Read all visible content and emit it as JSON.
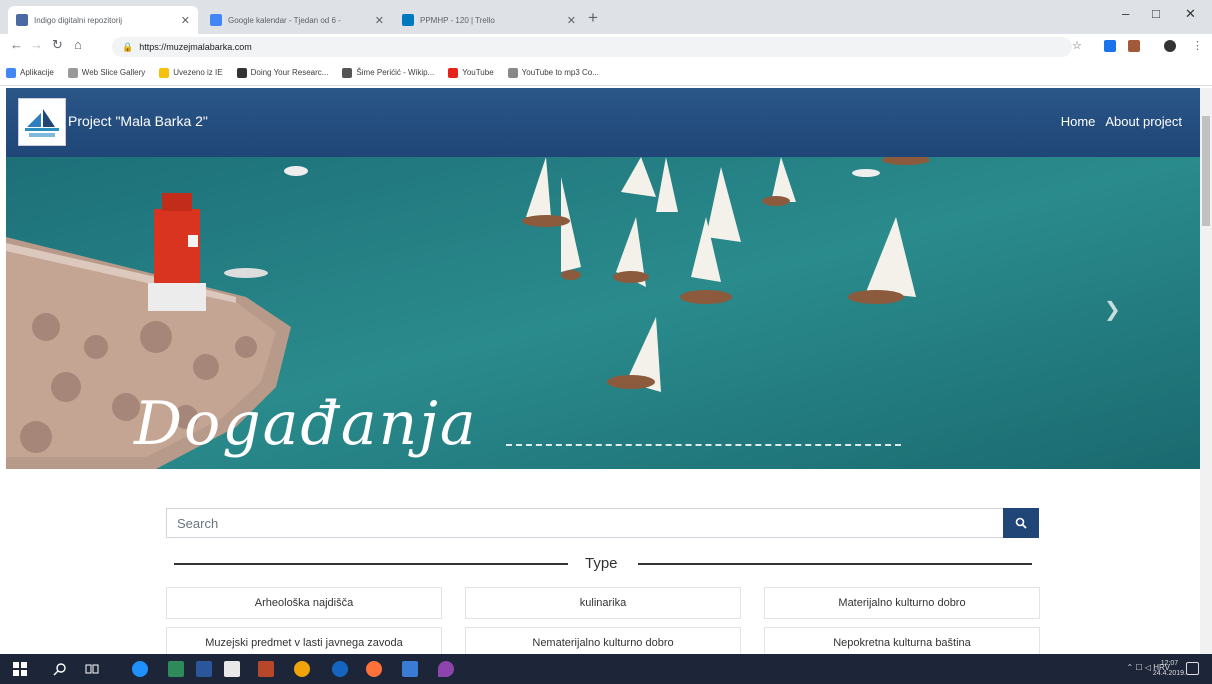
{
  "browser": {
    "tabs": [
      {
        "title": "Indigo digitalni repozitorij",
        "favicon_color": "#4b6aa5"
      },
      {
        "title": "Google kalendar - Tjedan od 6 -",
        "favicon_color": "#4285f4"
      },
      {
        "title": "PPMHP - 120 | Trello",
        "favicon_color": "#0079bf"
      }
    ],
    "new_tab": "+",
    "window_controls": [
      "–",
      "□",
      "✕"
    ],
    "url": "https://muzejmalabarka.com",
    "bookmarks": [
      {
        "label": "Aplikacije",
        "color": "#4285f4"
      },
      {
        "label": "Web Slice Gallery",
        "color": "#999999"
      },
      {
        "label": "Uvezeno iz IE",
        "color": "#f4c20d"
      },
      {
        "label": "Doing Your Researc...",
        "color": "#333333"
      },
      {
        "label": "Šime Perićić - Wikip...",
        "color": "#555555"
      },
      {
        "label": "YouTube",
        "color": "#e62117"
      },
      {
        "label": "YouTube to mp3 Co...",
        "color": "#888888"
      }
    ]
  },
  "site": {
    "brand": "Project \"Mala Barka 2\"",
    "nav": [
      "Home",
      "About project"
    ],
    "hero_title": "Događanja",
    "search_placeholder": "Search",
    "type_label": "Type",
    "filters": [
      "Arheološka najdišča",
      "kulinarika",
      "Materijalno kulturno dobro",
      "Muzejski predmet v lasti javnega zavoda",
      "Nematerijalno kulturno dobro",
      "Nepokretna kulturna baština"
    ]
  },
  "taskbar": {
    "tray_text": "HRV",
    "time": "12:07",
    "date": "24.4.2019."
  }
}
